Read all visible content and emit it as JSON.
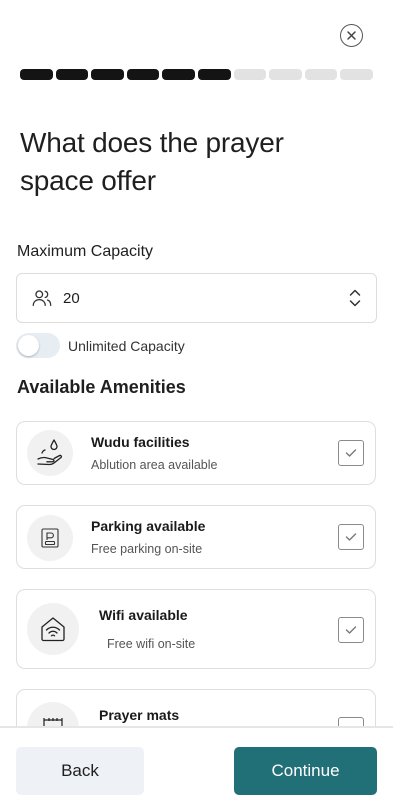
{
  "header": {
    "close_icon": "close-circle-icon",
    "progress": {
      "total_steps": 10,
      "completed_steps": 6
    }
  },
  "title": "What does the prayer space offer",
  "capacity": {
    "label": "Maximum Capacity",
    "value": "20",
    "icon": "people-icon",
    "stepper_icon": "up-down-chevron-icon"
  },
  "unlimited": {
    "label": "Unlimited Capacity",
    "enabled": false
  },
  "amenities": {
    "title": "Available Amenities",
    "items": [
      {
        "name": "Wudu facilities",
        "desc": "Ablution area available",
        "icon": "wudu-hand-water-icon",
        "checked": true
      },
      {
        "name": "Parking available",
        "desc": "Free parking on-site",
        "icon": "parking-sign-icon",
        "checked": true
      },
      {
        "name": "Wifi available",
        "desc": "Free wifi on-site",
        "icon": "wifi-icon",
        "checked": true
      },
      {
        "name": "Prayer mats",
        "desc": "",
        "icon": "prayer-mat-icon",
        "checked": false
      }
    ]
  },
  "footer": {
    "back_label": "Back",
    "continue_label": "Continue"
  },
  "colors": {
    "primary": "#216f77",
    "progress_done": "#141414",
    "progress_todo": "#e2e2e2"
  }
}
